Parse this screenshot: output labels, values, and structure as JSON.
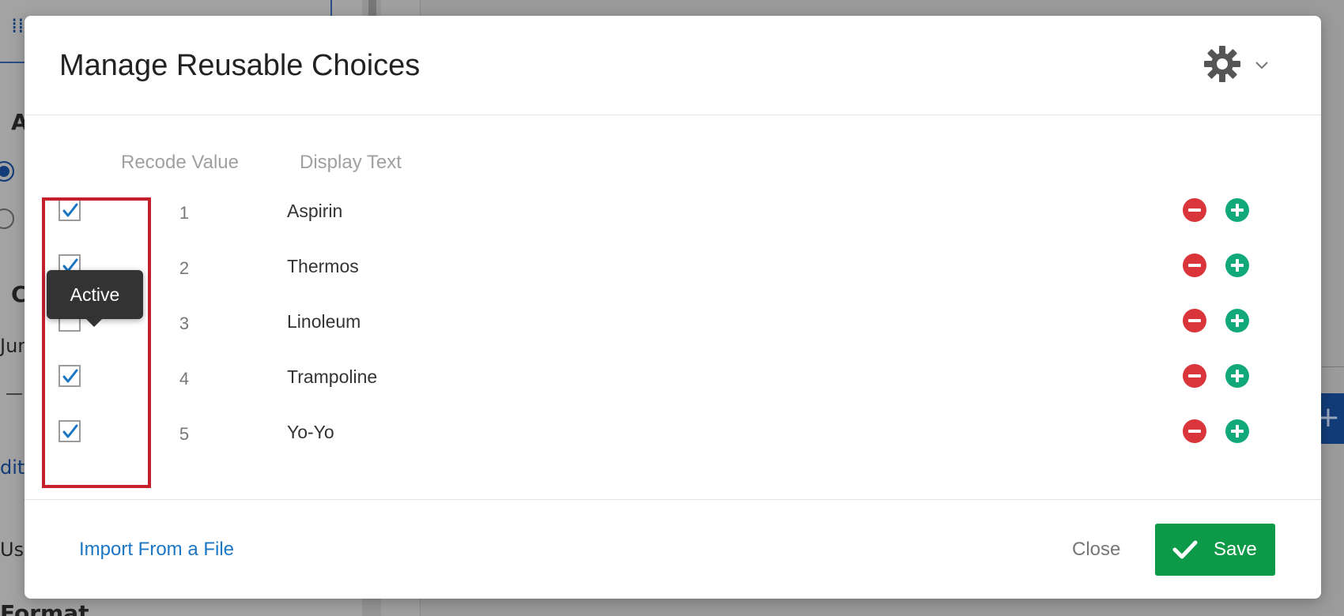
{
  "background": {
    "fragments": [
      "A",
      "C",
      "Jun",
      "dit",
      "Use",
      "Format"
    ]
  },
  "modal": {
    "title": "Manage Reusable Choices",
    "gear_icon": "gear-icon",
    "dropdown_icon": "chevron-down-icon"
  },
  "table": {
    "headers": {
      "recode": "Recode Value",
      "display": "Display Text"
    },
    "rows": [
      {
        "recode": "1",
        "display": "Aspirin",
        "active": true
      },
      {
        "recode": "2",
        "display": "Thermos",
        "active": true
      },
      {
        "recode": "3",
        "display": "Linoleum",
        "active": false
      },
      {
        "recode": "4",
        "display": "Trampoline",
        "active": true
      },
      {
        "recode": "5",
        "display": "Yo-Yo",
        "active": true
      }
    ]
  },
  "tooltip": {
    "text": "Active"
  },
  "footer": {
    "import_label": "Import From a File",
    "close_label": "Close",
    "save_label": "Save"
  },
  "colors": {
    "remove": "#d9353b",
    "add": "#12a97a",
    "save": "#0d9a48",
    "link": "#1b76c3",
    "check": "#1b76c3",
    "highlight": "#c3202c"
  }
}
